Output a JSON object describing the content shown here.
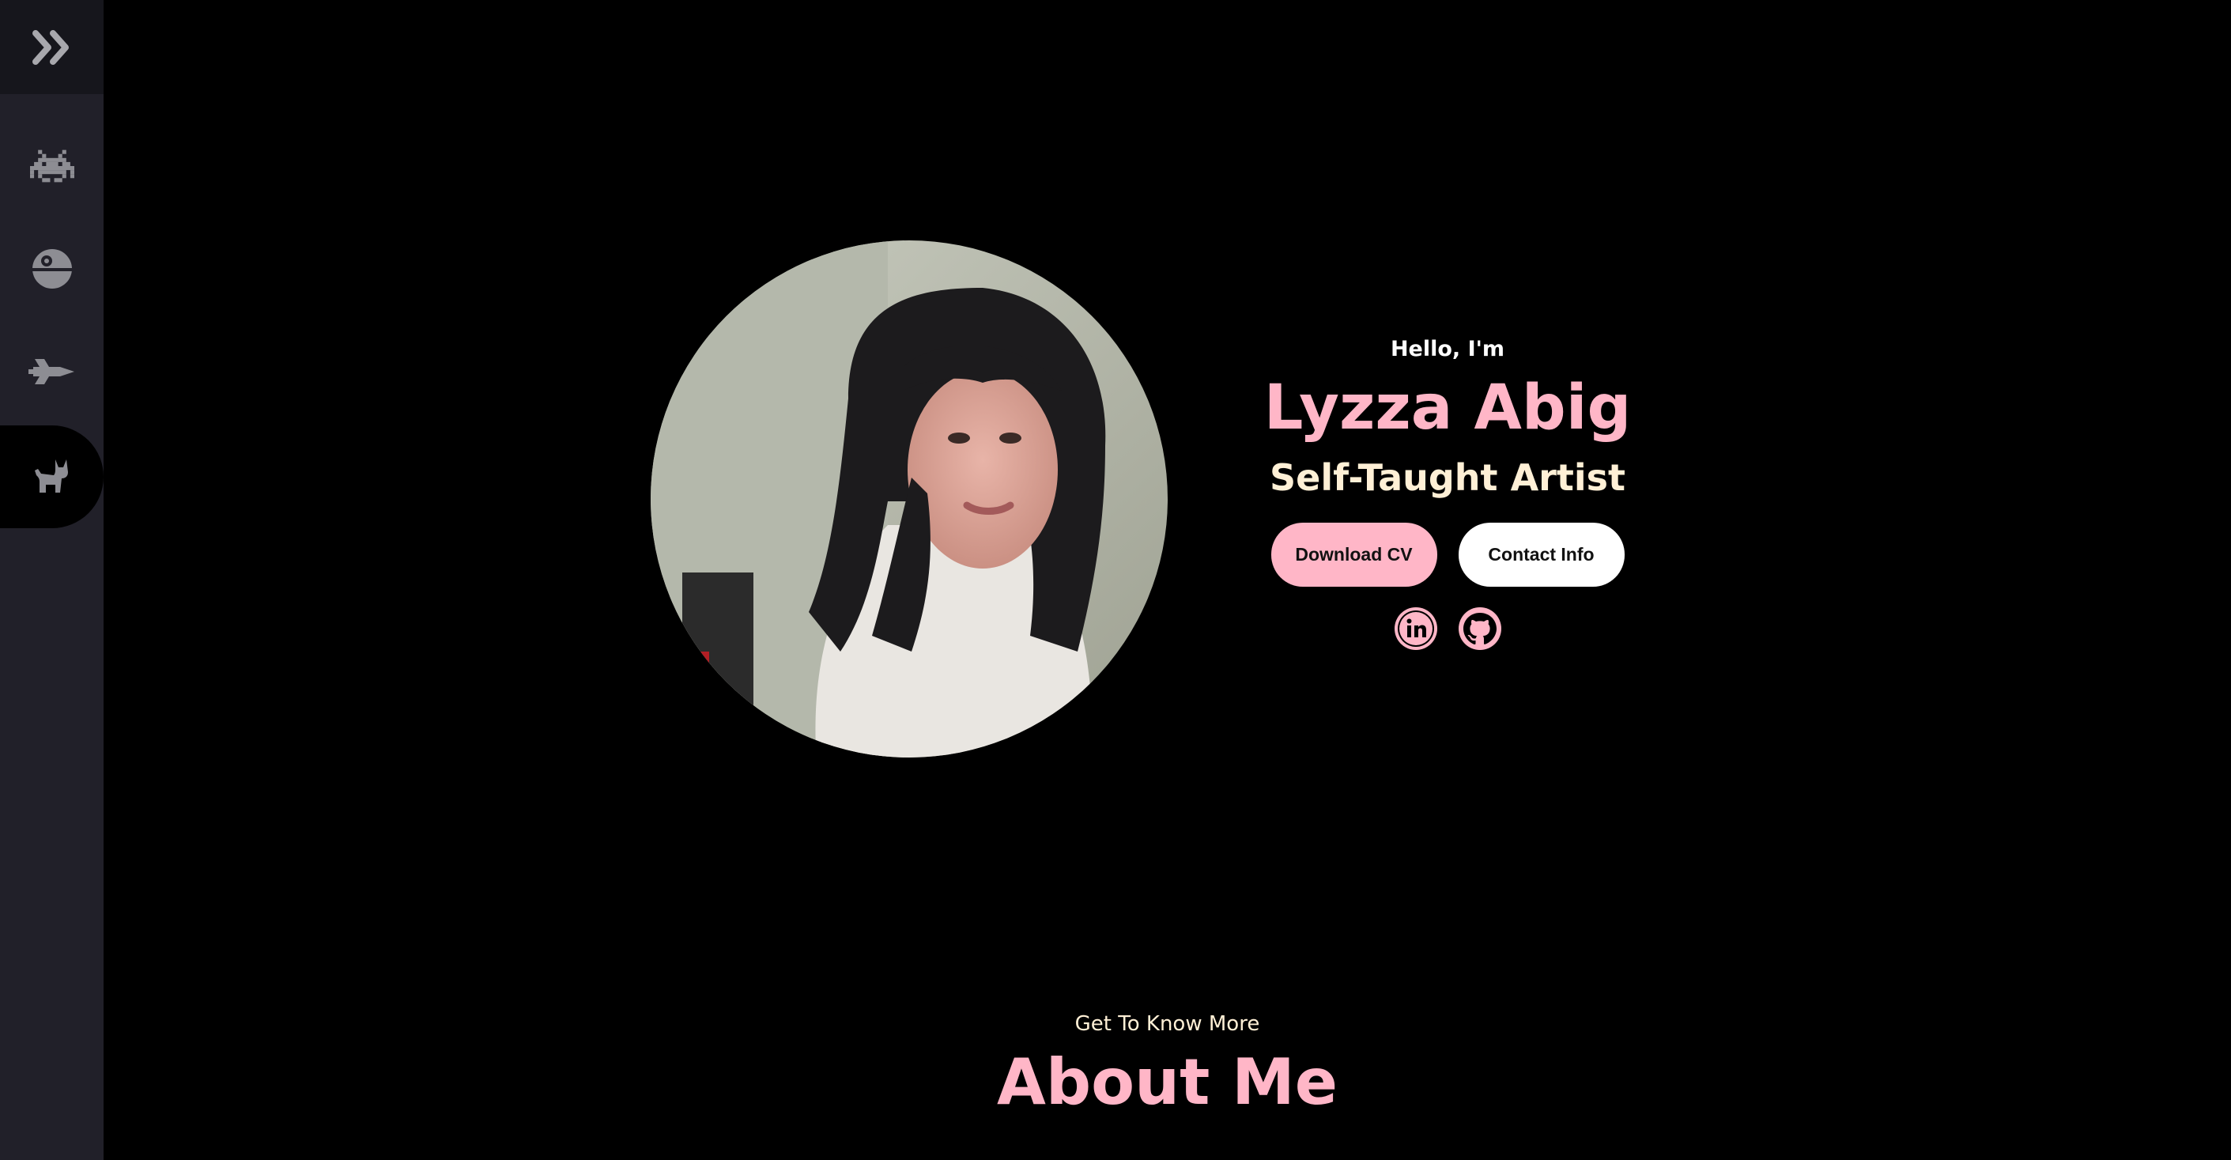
{
  "sidebar": {
    "toggle_icon": "double-chevron-right-icon",
    "items": [
      {
        "icon": "space-invader-icon",
        "active": false
      },
      {
        "icon": "death-star-icon",
        "active": false
      },
      {
        "icon": "spaceship-icon",
        "active": false
      },
      {
        "icon": "cat-icon",
        "active": true
      }
    ]
  },
  "hero": {
    "greeting": "Hello, I'm",
    "name": "Lyzza Abig",
    "title": "Self-Taught Artist",
    "buttons": {
      "download_cv": "Download CV",
      "contact_info": "Contact Info"
    },
    "social": [
      "linkedin-icon",
      "github-icon"
    ]
  },
  "about": {
    "subtitle": "Get To Know More",
    "title": "About Me"
  },
  "colors": {
    "accent_pink": "#ffb6c7",
    "cream": "#fff0d6",
    "sidebar_bg": "#212029",
    "sidebar_toggle_bg": "#16161c",
    "background": "#000000"
  }
}
